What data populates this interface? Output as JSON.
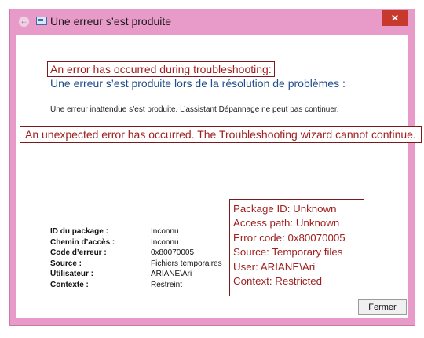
{
  "window": {
    "title": "Une erreur s’est produite",
    "close_glyph": "✕",
    "close_icon": "close-icon",
    "back_icon": "back-arrow-icon",
    "title_icon": "troubleshooting-window-icon"
  },
  "main": {
    "heading_en": "An error has occurred during troubleshooting:",
    "heading_fr": "Une erreur s’est produite lors de la résolution de problèmes :",
    "info_fr": "Une erreur inattendue s’est produite. L’assistant Dépannage ne peut pas continuer.",
    "info_en": "An unexpected error has occurred. The Troubleshooting wizard cannot continue."
  },
  "details": [
    {
      "label": "ID du package :",
      "value": "Inconnu"
    },
    {
      "label": "Chemin d’accès :",
      "value": "Inconnu"
    },
    {
      "label": "Code d’erreur :",
      "value": "0x80070005"
    },
    {
      "label": "Source :",
      "value": "Fichiers temporaires"
    },
    {
      "label": "Utilisateur :",
      "value": "ARIANE\\Ari"
    },
    {
      "label": "Contexte :",
      "value": "Restreint"
    }
  ],
  "details_en": [
    "Package ID: Unknown",
    "Access path: Unknown",
    "Error code: 0x80070005",
    "Source: Temporary files",
    "User: ARIANE\\Ari",
    "Context: Restricted"
  ],
  "footer": {
    "close_label": "Fermer"
  },
  "colors": {
    "frame": "#e89ac8",
    "annotation": "#a01f1f",
    "heading": "#1f4e8c",
    "close": "#c7392d"
  }
}
